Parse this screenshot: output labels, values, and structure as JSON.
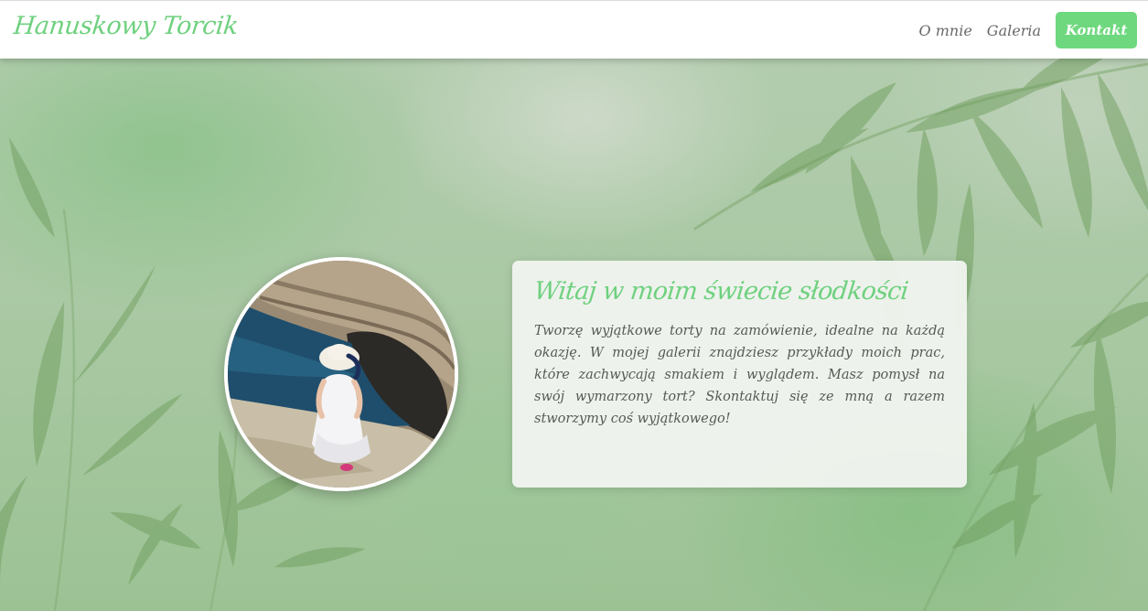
{
  "navbar": {
    "brand": "Hanuskowy Torcik",
    "links": [
      {
        "label": "O mnie"
      },
      {
        "label": "Galeria"
      }
    ],
    "cta_label": "Kontakt"
  },
  "hero": {
    "photo_icon": "profile-photo",
    "card": {
      "title": "Witaj w moim świecie słodkości",
      "text": "Tworzę wyjątkowe torty na zamówienie, idealne na każdą okazję. W mojej galerii znajdziesz przykłady moich prac, które zachwycają smakiem i wyglądem. Masz pomysł na swój wymarzony tort? Skontaktuj się ze mną a razem stworzymy coś wyjątkowego!"
    }
  },
  "colors": {
    "accent": "#6fd17f",
    "cta_background": "#6ed87e",
    "nav_text": "#666a66",
    "body_text": "#555a55"
  }
}
